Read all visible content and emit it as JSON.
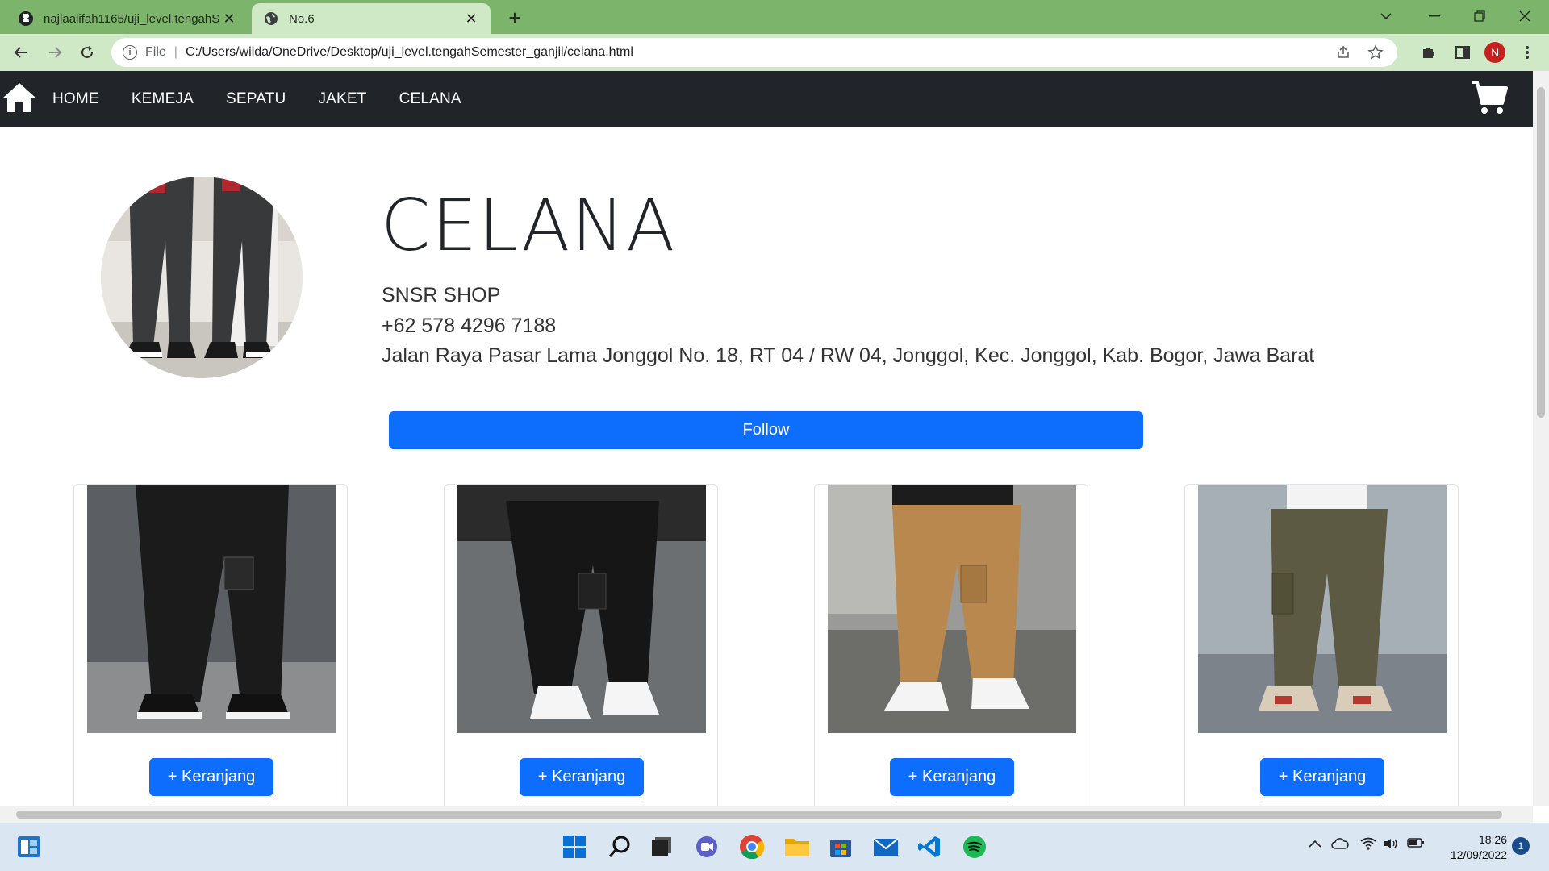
{
  "browser": {
    "tabs": [
      {
        "title": "najlaalifah1165/uji_level.tengahS",
        "icon": "github-icon"
      },
      {
        "title": "No.6",
        "icon": "globe-icon"
      }
    ],
    "new_tab_label": "+",
    "address": {
      "scheme_label": "File",
      "separator": "|",
      "url": "C:/Users/wilda/OneDrive/Desktop/uji_level.tengahSemester_ganjil/celana.html"
    },
    "profile_initial": "N"
  },
  "site": {
    "nav": {
      "links": [
        "HOME",
        "KEMEJA",
        "SEPATU",
        "JAKET",
        "CELANA"
      ]
    },
    "header": {
      "title": "CELANA",
      "shop_name": "SNSR SHOP",
      "phone": "+62 578 4296 7188",
      "address": "Jalan Raya Pasar Lama Jonggol No. 18, RT 04 / RW 04, Jonggol, Kec. Jonggol, Kab. Bogor, Jawa Barat"
    },
    "follow_label": "Follow",
    "products": [
      {
        "button_label": "+ Keranjang",
        "pants_color": "#1b1b1b"
      },
      {
        "button_label": "+ Keranjang",
        "pants_color": "#161616"
      },
      {
        "button_label": "+ Keranjang",
        "pants_color": "#b8884f"
      },
      {
        "button_label": "+ Keranjang",
        "pants_color": "#5d5a44"
      }
    ]
  },
  "taskbar": {
    "time": "18:26",
    "date": "12/09/2022",
    "notification_count": "1"
  },
  "colors": {
    "tabbar": "#7db46c",
    "toolbar": "#cfe8c5",
    "nav_bg": "#212529",
    "primary": "#0d6efd"
  }
}
